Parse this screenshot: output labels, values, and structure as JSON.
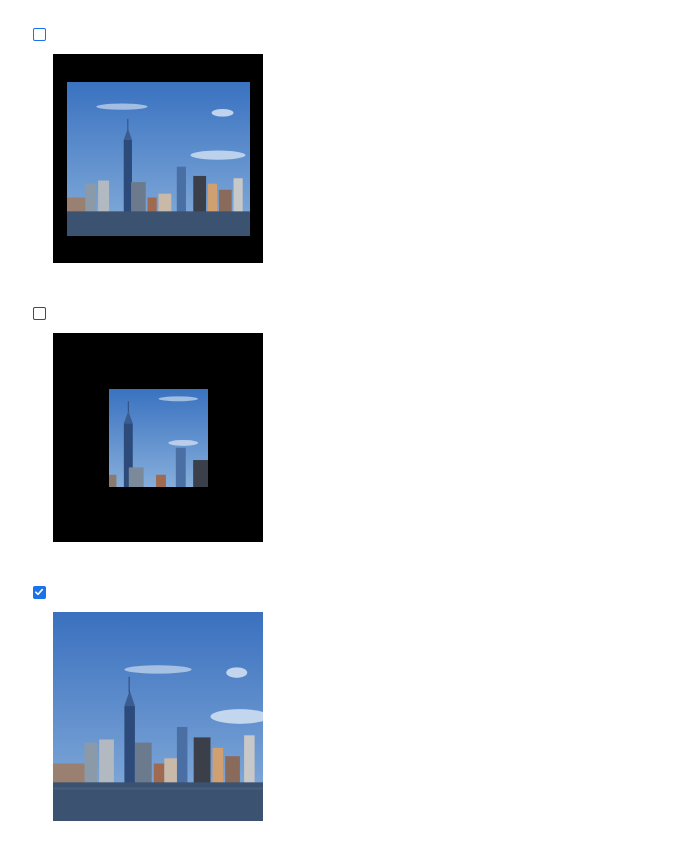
{
  "options": [
    {
      "checked": false,
      "focused": true,
      "image": "skyline-photo",
      "variant": "letterboxed-fit"
    },
    {
      "checked": false,
      "focused": false,
      "image": "skyline-photo",
      "variant": "centered-small"
    },
    {
      "checked": true,
      "focused": false,
      "image": "skyline-photo",
      "variant": "fill"
    }
  ],
  "colors": {
    "accent": "#1a73e8",
    "frame_background": "#000000",
    "sky_top": "#3f78c4",
    "sky_bottom": "#7fa9d8",
    "water": "#3b5270"
  }
}
